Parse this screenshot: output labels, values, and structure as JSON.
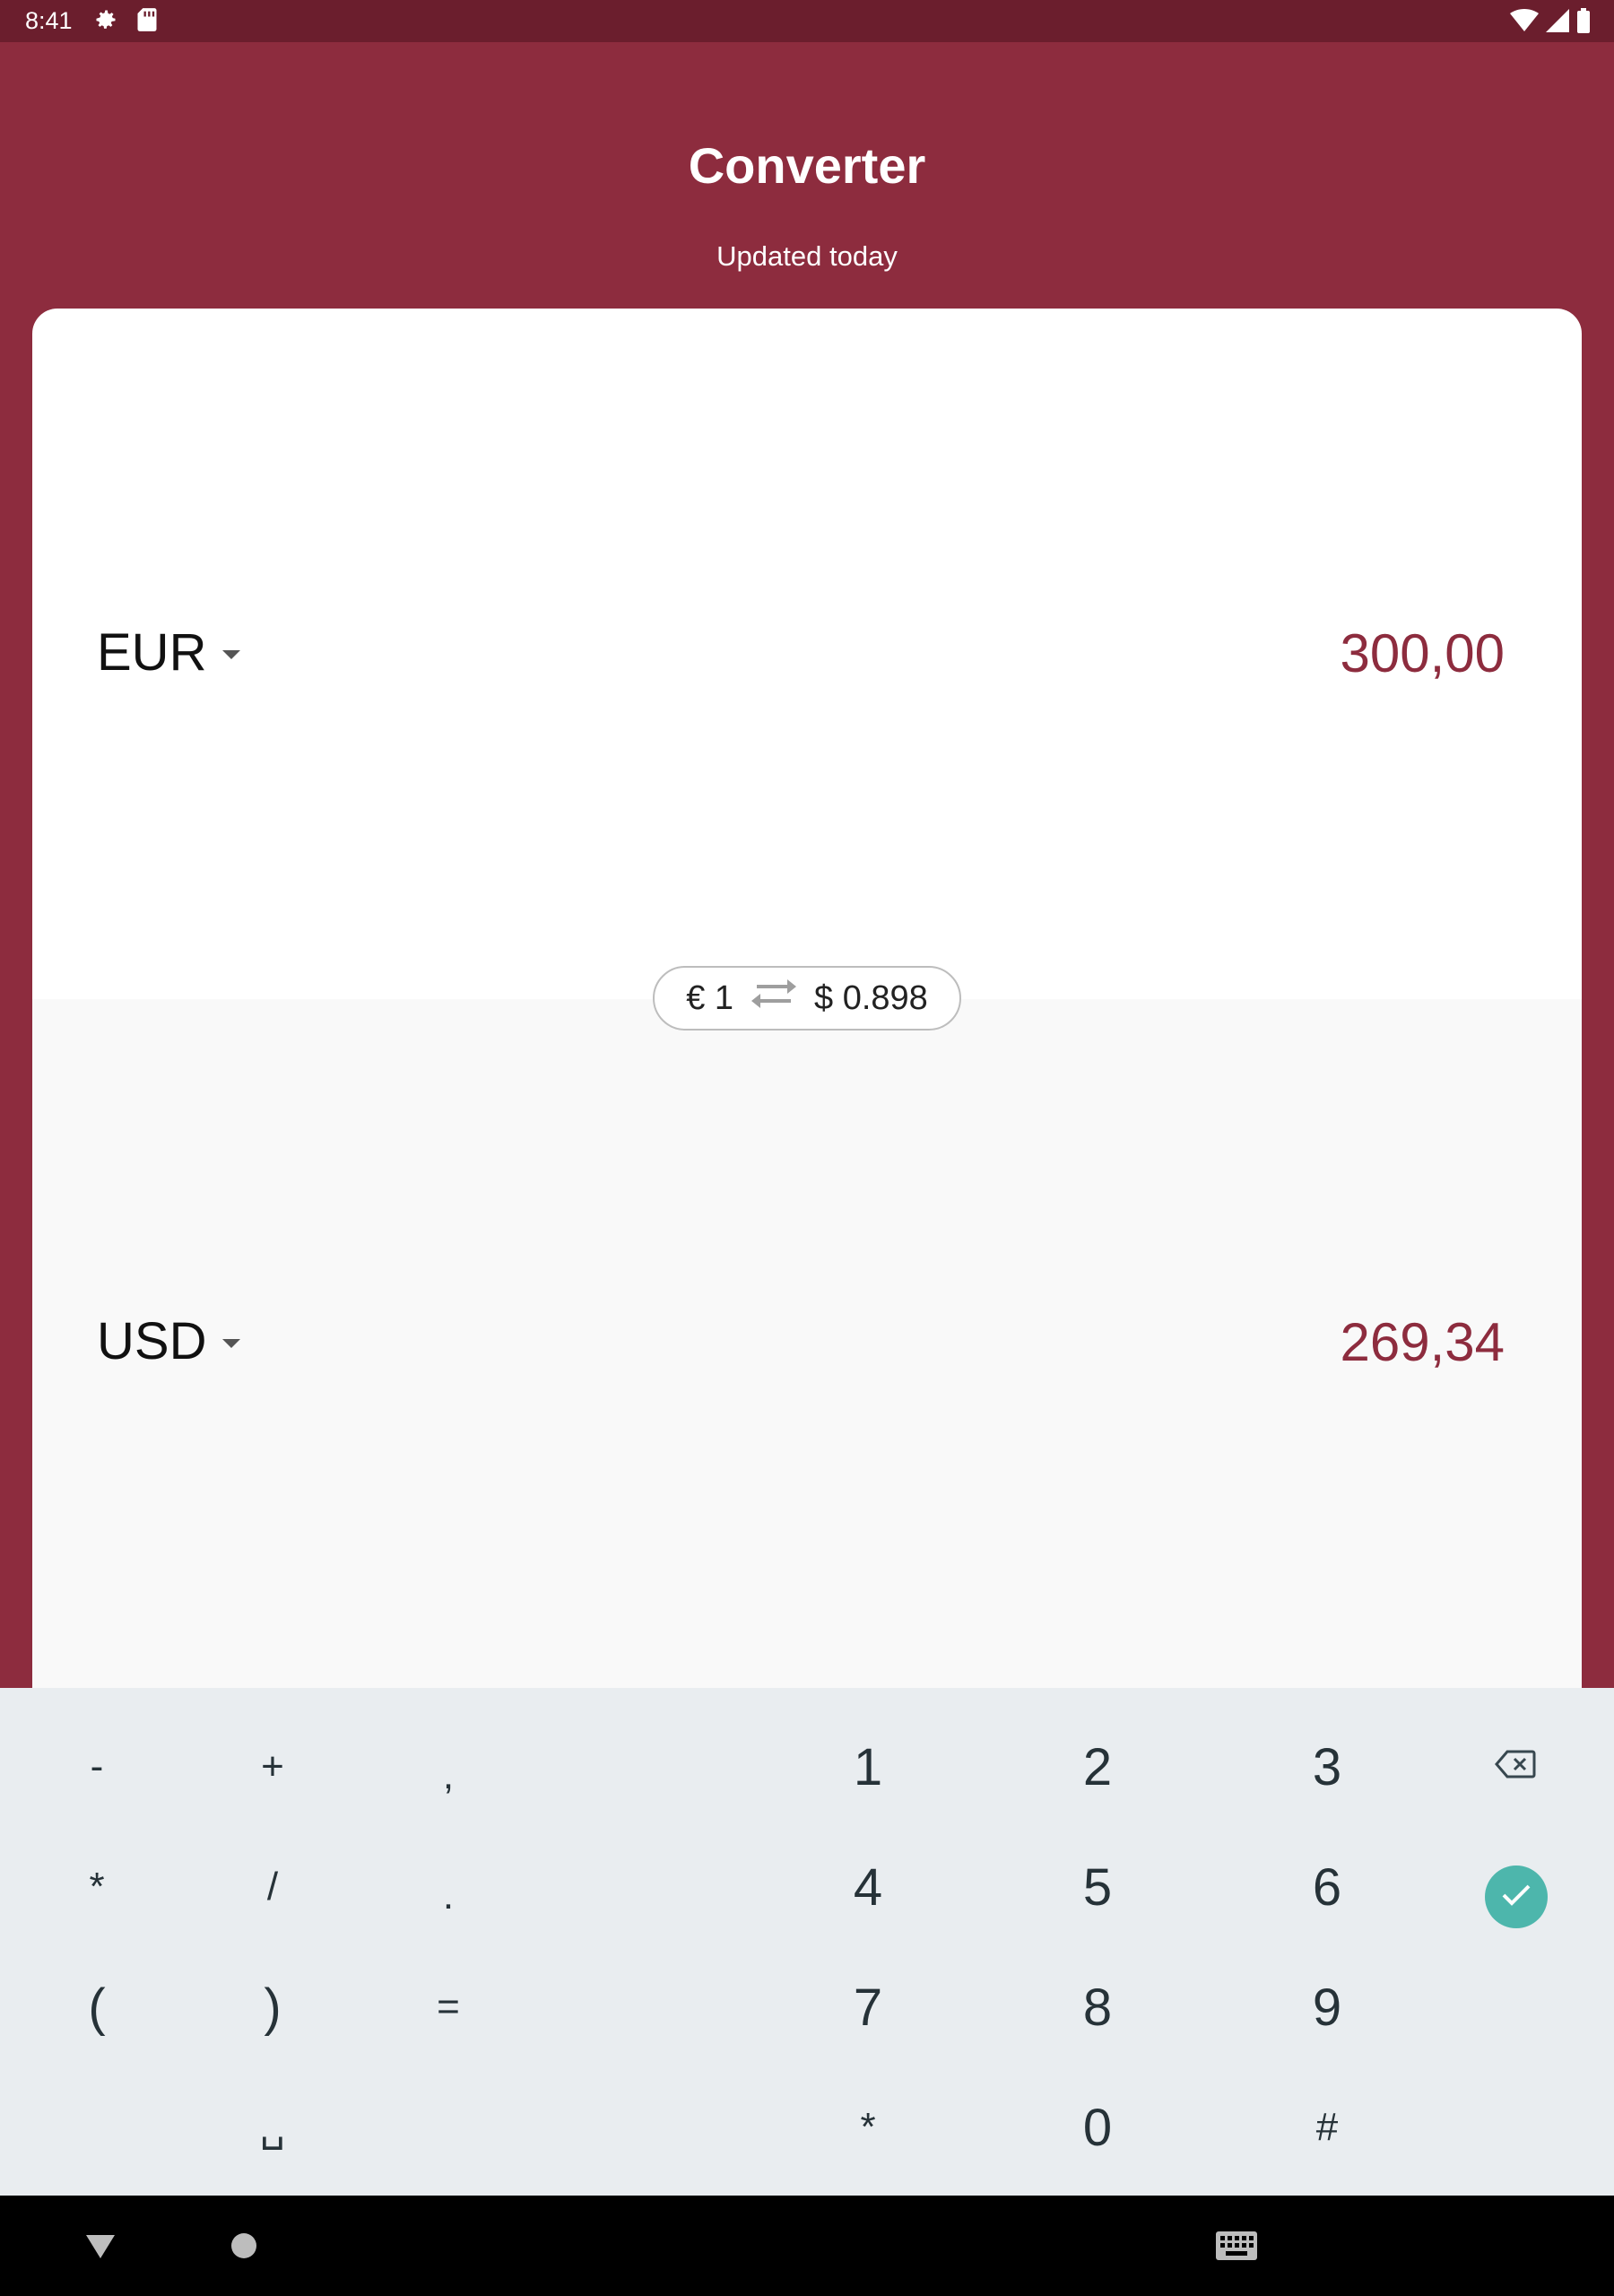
{
  "status_bar": {
    "time": "8:41",
    "icons": [
      "gear-icon",
      "sd-card-icon",
      "wifi-icon",
      "signal-icon",
      "battery-icon"
    ]
  },
  "header": {
    "title": "Converter",
    "subtitle": "Updated today"
  },
  "from": {
    "currency": "EUR",
    "amount": "300,00"
  },
  "to": {
    "currency": "USD",
    "amount": "269,34"
  },
  "rate": {
    "left": "€ 1",
    "right": "$ 0.898"
  },
  "keyboard": {
    "keys": {
      "minus": "-",
      "plus": "+",
      "comma": ",",
      "one": "1",
      "two": "2",
      "three": "3",
      "asterisk": "*",
      "slash": "/",
      "period": ".",
      "four": "4",
      "five": "5",
      "six": "6",
      "lparen": "(",
      "rparen": ")",
      "equals": "=",
      "seven": "7",
      "eight": "8",
      "nine": "9",
      "space": "␣",
      "star": "*",
      "zero": "0",
      "hash": "#"
    }
  },
  "colors": {
    "brand": "#8d2c3e",
    "status_bar": "#6b1e2d",
    "amount": "#8d2c3e",
    "confirm": "#4db6ac",
    "keyboard_bg": "#e9edf0"
  }
}
